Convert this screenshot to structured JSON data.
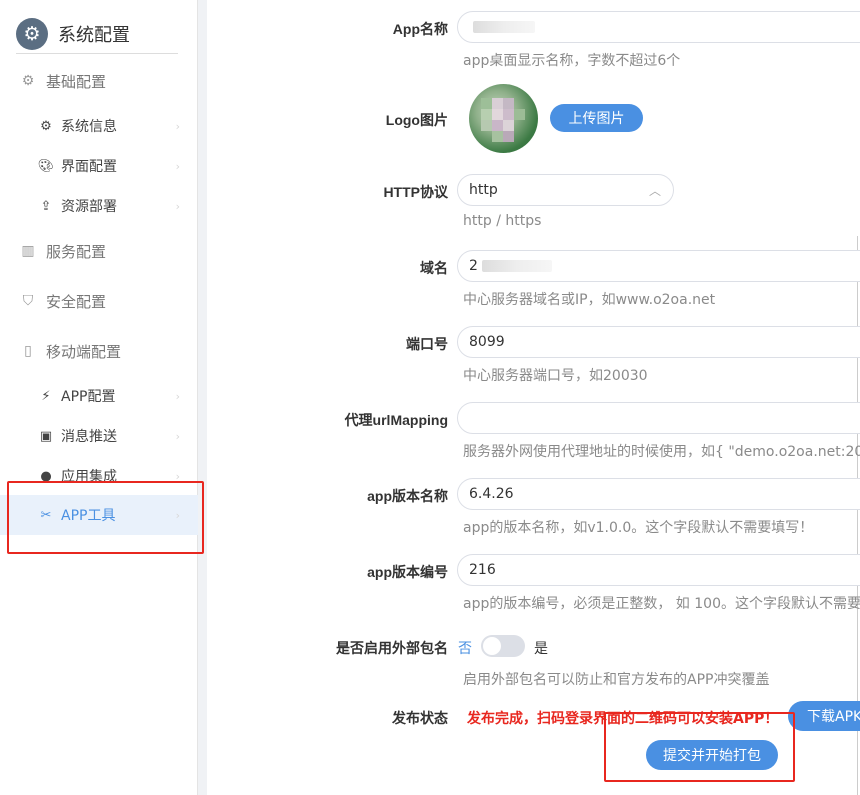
{
  "sidebar": {
    "title": "系统配置",
    "items": [
      {
        "label": "基础配置",
        "icon": "gear-icon"
      },
      {
        "label": "系统信息",
        "icon": "gear-icon"
      },
      {
        "label": "界面配置",
        "icon": "palette-icon"
      },
      {
        "label": "资源部署",
        "icon": "upload-icon"
      },
      {
        "label": "服务配置",
        "icon": "server-icon"
      },
      {
        "label": "安全配置",
        "icon": "shield-icon"
      },
      {
        "label": "移动端配置",
        "icon": "mobile-icon"
      },
      {
        "label": "APP配置",
        "icon": "plug-icon"
      },
      {
        "label": "消息推送",
        "icon": "message-icon"
      },
      {
        "label": "应用集成",
        "icon": "globe-icon"
      },
      {
        "label": "APP工具",
        "icon": "tools-icon"
      }
    ]
  },
  "form": {
    "app_name": {
      "label": "App名称",
      "value": "",
      "hint": "app桌面显示名称，字数不超过6个"
    },
    "logo": {
      "label": "Logo图片",
      "upload_button": "上传图片"
    },
    "http": {
      "label": "HTTP协议",
      "value": "http",
      "hint": "http / https"
    },
    "domain": {
      "label": "域名",
      "value": "2",
      "hint": "中心服务器域名或IP，如www.o2oa.net"
    },
    "port": {
      "label": "端口号",
      "value": "8099",
      "hint": "中心服务器端口号，如20030"
    },
    "url_mapping": {
      "label": "代理urlMapping",
      "value": "",
      "hint": "服务器外网使用代理地址的时候使用，如{ \"demo.o2oa.net:200"
    },
    "version_name": {
      "label": "app版本名称",
      "value": "6.4.26",
      "hint": "app的版本名称，如v1.0.0。这个字段默认不需要填写！"
    },
    "version_code": {
      "label": "app版本编号",
      "value": "216",
      "hint": "app的版本编号，必须是正整数， 如 100。这个字段默认不需要"
    },
    "external_package": {
      "label": "是否启用外部包名",
      "off": "否",
      "on": "是",
      "enabled": false,
      "hint": "启用外部包名可以防止和官方发布的APP冲突覆盖"
    },
    "publish_status": {
      "label": "发布状态",
      "message": "发布完成，扫码登录界面的二维码可以安装APP！",
      "download_button": "下载APK"
    },
    "submit_button": "提交并开始打包"
  },
  "colors": {
    "accent": "#4a90e2",
    "warning": "#e8271f"
  }
}
